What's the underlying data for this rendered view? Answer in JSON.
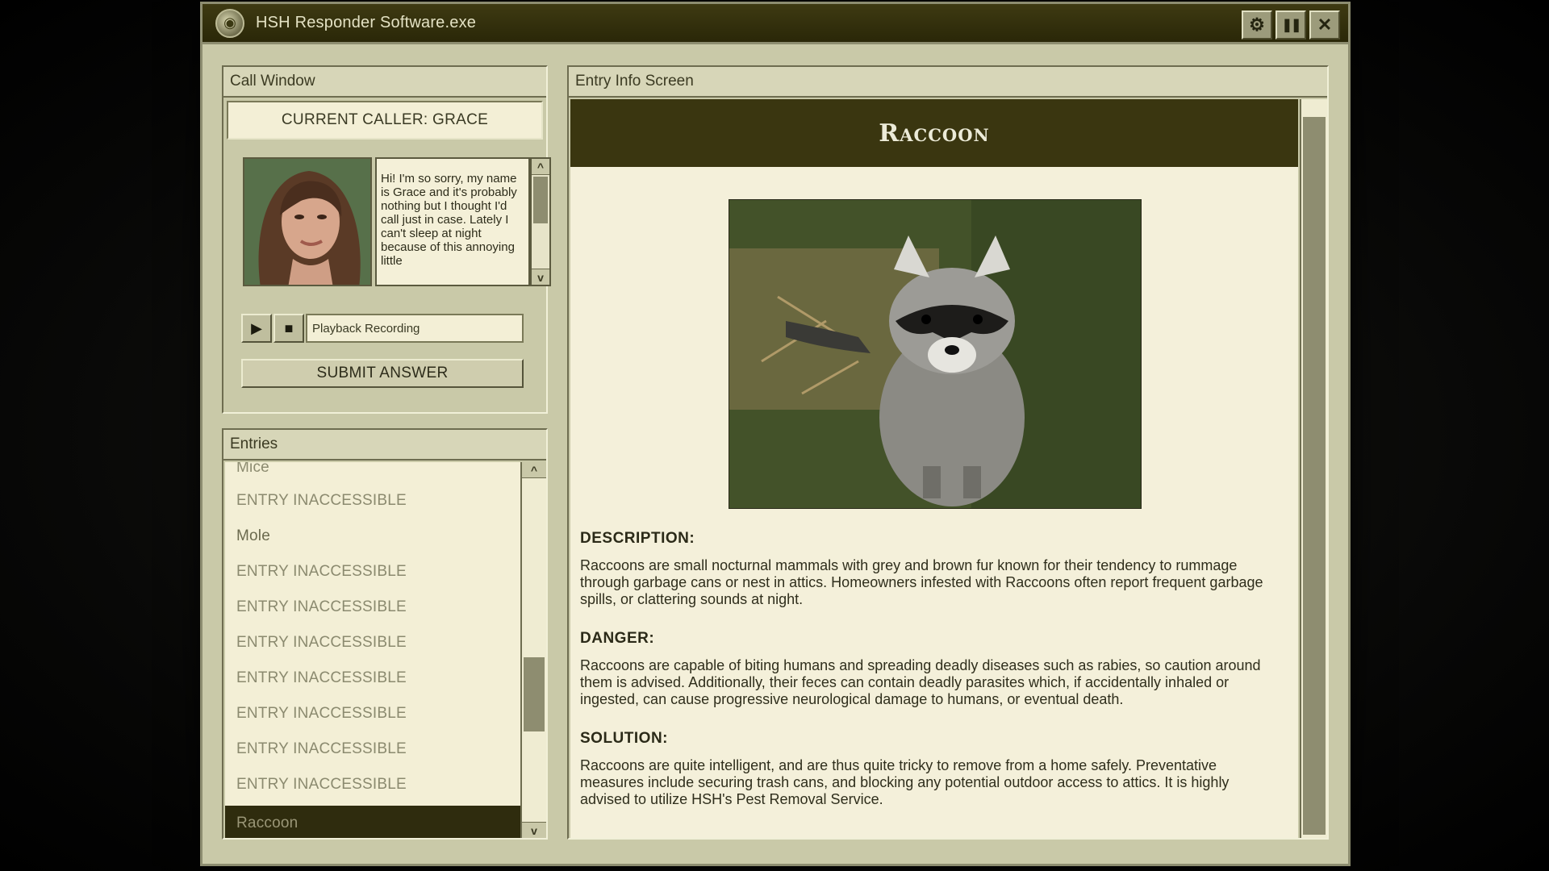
{
  "window": {
    "title": "HSH Responder Software.exe"
  },
  "controls": {
    "settings": "⚙",
    "pause": "❚❚",
    "close": "✕"
  },
  "call_window": {
    "header": "Call Window",
    "caller_label": "CURRENT CALLER: GRACE",
    "transcript": "Hi! I'm so sorry, my name is Grace and it's probably nothing but I thought I'd call just in case. Lately I can't sleep at night because of this annoying little",
    "playback_placeholder": "Playback Recording",
    "submit_label": "SUBMIT ANSWER",
    "scroll_up": "^",
    "scroll_down": "v",
    "play_glyph": "▶",
    "stop_glyph": "■"
  },
  "entries": {
    "header": "Entries",
    "partial_item": "Mice",
    "items": [
      "ENTRY INACCESSIBLE",
      "Mole",
      "ENTRY INACCESSIBLE",
      "ENTRY INACCESSIBLE",
      "ENTRY INACCESSIBLE",
      "ENTRY INACCESSIBLE",
      "ENTRY INACCESSIBLE",
      "ENTRY INACCESSIBLE",
      "ENTRY INACCESSIBLE"
    ],
    "selected": "Raccoon",
    "scroll_up": "^",
    "scroll_down": "v"
  },
  "info": {
    "header": "Entry Info Screen",
    "animal_name": "Raccoon",
    "description_heading": "DESCRIPTION:",
    "description": "Raccoons are small nocturnal mammals with grey and brown fur known for their tendency to rummage through garbage cans or nest in attics. Homeowners infested with Raccoons often report frequent garbage spills, or clattering sounds at night.",
    "danger_heading": "DANGER:",
    "danger": "Raccoons are capable of biting humans and spreading deadly diseases such as rabies, so caution around them is advised. Additionally, their feces can contain deadly parasites which, if accidentally inhaled or ingested, can cause progressive neurological damage to humans, or eventual death.",
    "solution_heading": "SOLUTION:",
    "solution": "Raccoons are quite intelligent, and are thus quite tricky to remove from a home safely. Preventative measures include securing trash cans, and blocking any potential outdoor access to attics. It is highly advised to utilize HSH's Pest Removal Service."
  },
  "colors": {
    "titlebar": "#2a2708",
    "panel": "#c9c9a8",
    "paper": "#f4f0da",
    "selected": "#2f2c0e"
  },
  "icons": [
    "app-logo-icon",
    "gear-icon",
    "pause-icon",
    "close-icon",
    "play-icon",
    "stop-icon"
  ]
}
